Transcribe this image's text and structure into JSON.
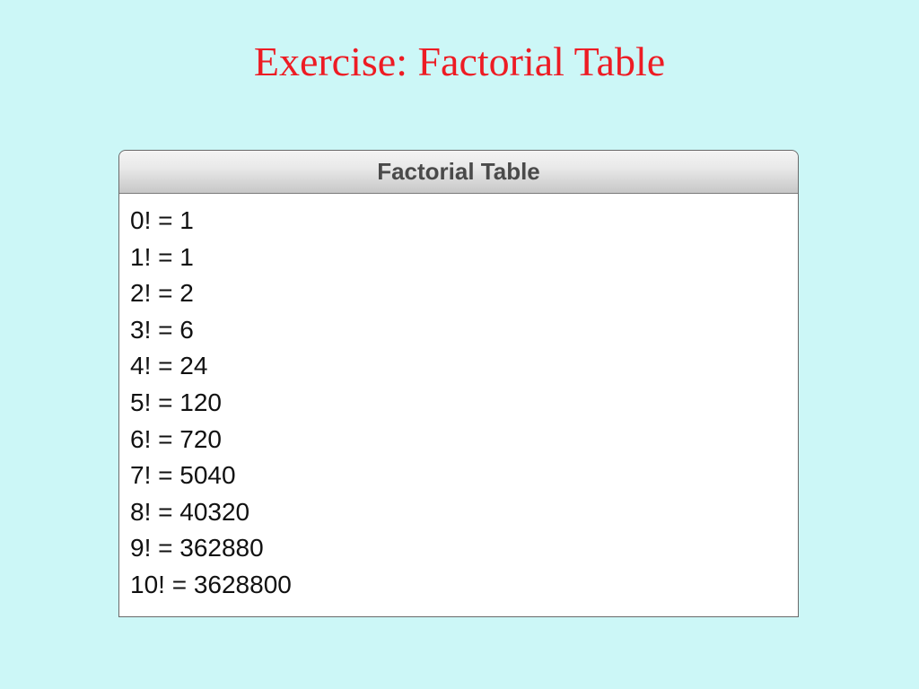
{
  "slide": {
    "title": "Exercise: Factorial Table"
  },
  "window": {
    "title": "Factorial Table"
  },
  "rows": [
    "0! = 1",
    "1! = 1",
    "2! = 2",
    "3! = 6",
    "4! = 24",
    "5! = 120",
    "6! = 720",
    "7! = 5040",
    "8! = 40320",
    "9! = 362880",
    "10! = 3628800"
  ]
}
